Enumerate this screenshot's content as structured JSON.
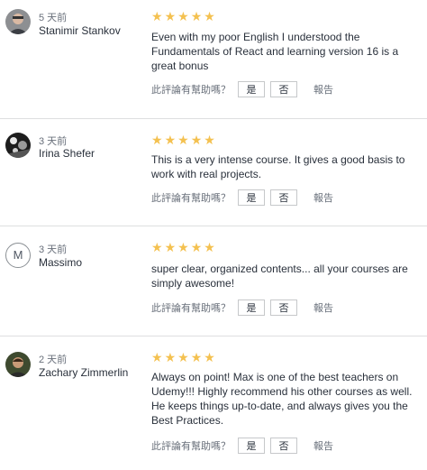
{
  "reviews": [
    {
      "time": "5 天前",
      "name": "Stanimir Stankov",
      "avatar": "photo",
      "stars": 5,
      "text": "Even with my poor English I understood the Fundamentals of React and learning version 16 is a great bonus"
    },
    {
      "time": "3 天前",
      "name": "Irina Shefer",
      "avatar": "photo",
      "stars": 5,
      "text": "This is a very intense course. It gives a good basis to work with real projects."
    },
    {
      "time": "3 天前",
      "name": "Massimo",
      "avatar": "M",
      "stars": 5,
      "text": "super clear, organized contents... all your courses are simply awesome!"
    },
    {
      "time": "2 天前",
      "name": "Zachary Zimmerlin",
      "avatar": "photo",
      "stars": 5,
      "text": "Always on point! Max is one of the best teachers on Udemy!!! Highly recommend his other courses as well. He keeps things up-to-date, and always gives you the Best Practices."
    }
  ],
  "helpful": {
    "question": "此評論有幫助嗎？",
    "yes": "是",
    "no": "否",
    "report": "報告"
  },
  "colors": {
    "star": "#f4c150",
    "text": "#29303b",
    "muted": "#686f7a",
    "divider": "#dedfe0"
  }
}
